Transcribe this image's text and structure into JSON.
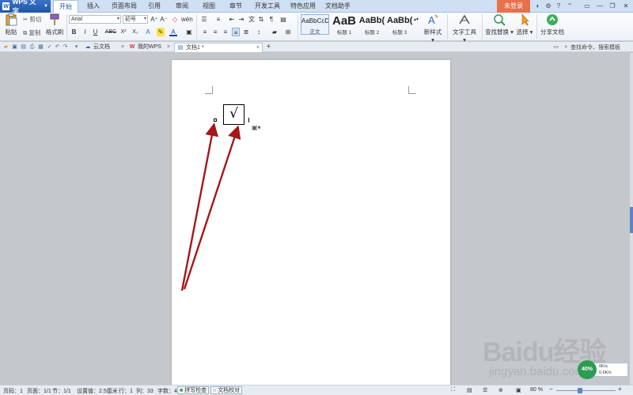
{
  "app": {
    "logo_text": "W",
    "name": "WPS 文字",
    "login_label": "未登录"
  },
  "menu_tabs": [
    "开始",
    "插入",
    "页面布局",
    "引用",
    "审阅",
    "视图",
    "章节",
    "开发工具",
    "特色应用",
    "文档助手"
  ],
  "active_menu_tab": "开始",
  "ribbon": {
    "paste_label": "粘贴",
    "cut_label": "剪切",
    "copy_label": "复制",
    "format_painter_label": "格式刷",
    "font_name": "Arial",
    "font_size": "初号",
    "bold_label": "B",
    "italic_label": "I",
    "underline_label": "U",
    "strike_label": "ABC",
    "superscript_label": "X²",
    "subscript_label": "X₂",
    "styles": [
      {
        "preview": "AaBbCcDd",
        "caption": "正文"
      },
      {
        "preview": "AaB",
        "caption": "标题 1"
      },
      {
        "preview": "AaBb(",
        "caption": "标题 2"
      },
      {
        "preview": "AaBb(",
        "caption": "标题 3"
      }
    ],
    "new_style_label": "新样式",
    "text_tools_label": "文字工具",
    "find_replace_label": "查找替换",
    "select_label": "选择",
    "share_doc_label": "分享文档"
  },
  "tabbar": {
    "tabs": [
      {
        "label": "云文档",
        "icon": "cloud-icon"
      },
      {
        "label": "我的WPS",
        "icon": "wps-icon"
      },
      {
        "label": "文档1 *",
        "icon": "doc-icon",
        "active": true
      }
    ],
    "add_tab_label": "+",
    "search_placeholder": "查找命令、搜索模板"
  },
  "document": {
    "checkbox_symbol": "√"
  },
  "statusbar": {
    "page_label": "页码：1",
    "pages_label": "页面：1/1",
    "section_label": "节：1/1",
    "setting_label": "设置值：2.5厘米",
    "row_label": "行：1",
    "col_label": "列：33",
    "words_label": "字数：4",
    "spellcheck_label": "拼写检查",
    "proofread_label": "文档校对",
    "zoom_label": "80 %",
    "zoom_minus": "−",
    "zoom_plus": "+"
  },
  "network_widget": {
    "percent": "40%",
    "up": "0K/s",
    "down": "0.6K/s"
  },
  "watermark": {
    "logo": "Baidu经验",
    "url": "jingyan.baidu.com"
  },
  "colors": {
    "accent": "#1f56a8",
    "login": "#e8704a",
    "annotation_arrow": "#a5171a",
    "network_ok": "#2e9b53"
  }
}
